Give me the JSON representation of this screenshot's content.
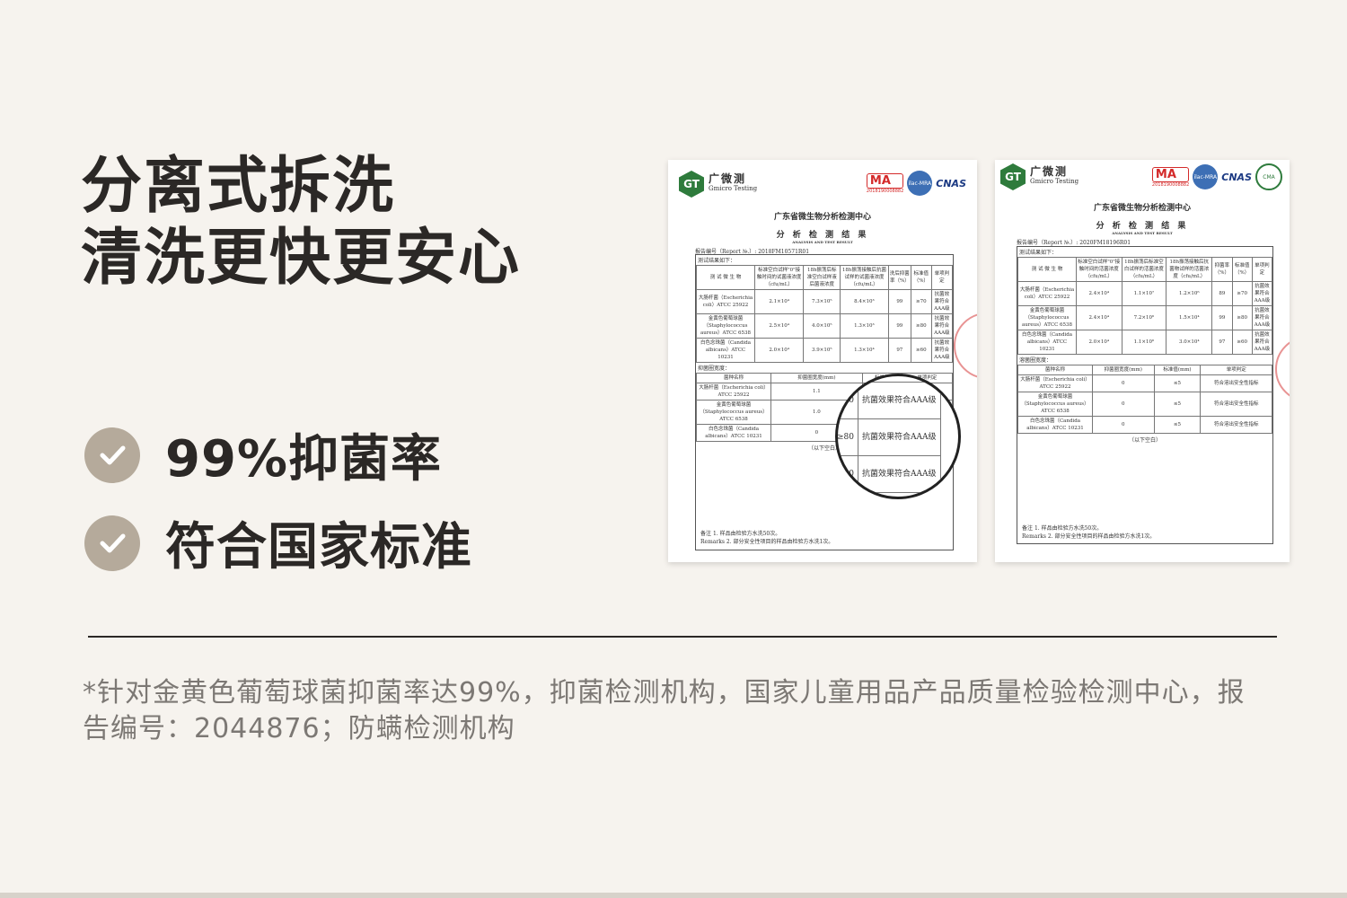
{
  "headline": {
    "line1": "分离式拆洗",
    "line2": "清洗更快更安心"
  },
  "features": [
    {
      "label": "99%抑菌率",
      "icon": "check-icon"
    },
    {
      "label": "符合国家标准",
      "icon": "check-icon"
    }
  ],
  "colors": {
    "background": "#f6f3ee",
    "check_circle": "#b5aa9b",
    "text": "#2b2826",
    "footnote": "#7c7874"
  },
  "footnote": "*针对金黄色葡萄球菌抑菌率达99%，抑菌检测机构，国家儿童用品产品质量检验检测中心，报告编号：2044876；防螨检测机构",
  "report1": {
    "logo_cn": "广微测",
    "logo_en": "Gmicro Testing",
    "badge": "GT",
    "ma_code": "2018190008882",
    "title": "广东省微生物分析检测中心",
    "subtitle": "分 析 检 测 结 果",
    "subtitle_en": "ANALYSIS AND TEST RESULT",
    "report_no": "报告编号（Report №.）: 2018FM10571R01",
    "section1": "测试结果如下：",
    "headers": [
      "测 试 微 生 物",
      "标准空白试样\"0\"接触时间的试菌液浓度（cfu/mL）",
      "18h振荡后标准空白试样液后菌液浓度",
      "18h振荡接触后抗菌试样的试菌液浓度（cfu/mL）",
      "洗后抑菌率（%）",
      "标准值（%）",
      "单项判定"
    ],
    "rows": [
      [
        "大肠杆菌（Escherichia coli）ATCC 25922",
        "2.1×10⁴",
        "7.3×10⁵",
        "8.4×10³",
        "99",
        "≥70",
        "抗菌效果符合AAA级"
      ],
      [
        "金黄色葡萄球菌（Staphylococcus aureus）ATCC 6538",
        "2.5×10⁴",
        "4.0×10⁵",
        "1.3×10³",
        "99",
        "≥80",
        "抗菌效果符合AAA级"
      ],
      [
        "白色念珠菌（Candida albicans）ATCC 10231",
        "2.0×10⁴",
        "3.9×10⁵",
        "1.3×10⁴",
        "97",
        "≥60",
        "抗菌效果符合AAA级"
      ]
    ],
    "section2": "抑菌圈宽度：",
    "headers2": [
      "菌种名称",
      "抑菌圈宽度(mm)",
      "标准值",
      "单项判定"
    ],
    "rows2": [
      [
        "大肠杆菌（Escherichia coli）ATCC 25922",
        "1.1"
      ],
      [
        "金黄色葡萄球菌（Staphylococcus aureus）ATCC 6538",
        "1.0"
      ],
      [
        "白色念珠菌（Candida albicans）ATCC 10231",
        "0"
      ]
    ],
    "end": "（以下空白）",
    "remark_label": "备注",
    "remark_en": "Remarks",
    "remark1": "1. 样品由检验方水洗50次。",
    "remark2": "2. 部分安全性项目的样品由检验方水洗1次。",
    "magnified": [
      [
        "≥70",
        "抗菌效果符合AAA级"
      ],
      [
        "≥80",
        "抗菌效果符合AAA级"
      ],
      [
        "≥60",
        "抗菌效果符合AAA级"
      ]
    ]
  },
  "report2": {
    "logo_cn": "广微测",
    "logo_en": "Gmicro Testing",
    "badge": "GT",
    "ma_code": "2018190008882",
    "title": "广东省微生物分析检测中心",
    "subtitle": "分 析 检 测 结 果",
    "subtitle_en": "ANALYSIS AND TEST RESULT",
    "report_no": "报告编号（Report №.）: 2020FM18196R01",
    "section1": "测试结果如下：",
    "headers": [
      "测 试 微 生 物",
      "标准空白试样\"0\"接触时间的活菌浓度（cfu/mL）",
      "18h振荡后标准空白试样的活菌浓度（cfu/mL）",
      "18h振荡接触后抗菌物试样的活菌浓度（cfu/mL）",
      "抑菌率（%）",
      "标准值（%）",
      "单项判定"
    ],
    "rows": [
      [
        "大肠杆菌（Escherichia coli）ATCC 25922",
        "2.4×10⁴",
        "1.1×10⁷",
        "1.2×10⁶",
        "89",
        "≥70",
        "抗菌效果符合AAA级"
      ],
      [
        "金黄色葡萄球菌（Staphylococcus aureus）ATCC 6538",
        "2.4×10⁴",
        "7.2×10⁶",
        "1.5×10⁴",
        "99",
        "≥80",
        "抗菌效果符合AAA级"
      ],
      [
        "白色念珠菌（Candida albicans）ATCC 10231",
        "2.0×10⁴",
        "1.1×10⁶",
        "3.0×10⁴",
        "97",
        "≥60",
        "抗菌效果符合AAA级"
      ]
    ],
    "section2": "溶菌圈宽度：",
    "headers2": [
      "菌种名称",
      "抑菌圈宽度(mm)",
      "标准值(mm)",
      "单项判定"
    ],
    "rows2": [
      [
        "大肠杆菌（Escherichia coli）ATCC 25922",
        "0",
        "≤5",
        "符合溶出安全性指标"
      ],
      [
        "金黄色葡萄球菌（Staphylococcus aureus）ATCC 6538",
        "0",
        "≤5",
        "符合溶出安全性指标"
      ],
      [
        "白色念珠菌（Candida albicans）ATCC 10231",
        "0",
        "≤5",
        "符合溶出安全性指标"
      ]
    ],
    "end": "（以下空白）",
    "remark_label": "备注",
    "remark_en": "Remarks",
    "remark1": "1. 样品由检验方水洗50次。",
    "remark2": "2. 部分安全性项目的样品由检验方水洗1次。"
  }
}
